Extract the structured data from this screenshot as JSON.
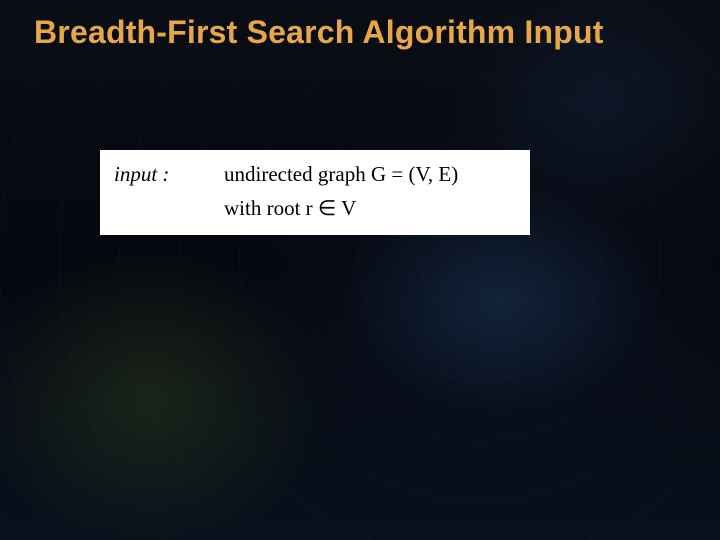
{
  "slide": {
    "title": "Breadth-First Search Algorithm Input",
    "input_label": "input :",
    "input_line1": "undirected graph G = (V, E)",
    "input_line2": "with root r ∈ V"
  }
}
